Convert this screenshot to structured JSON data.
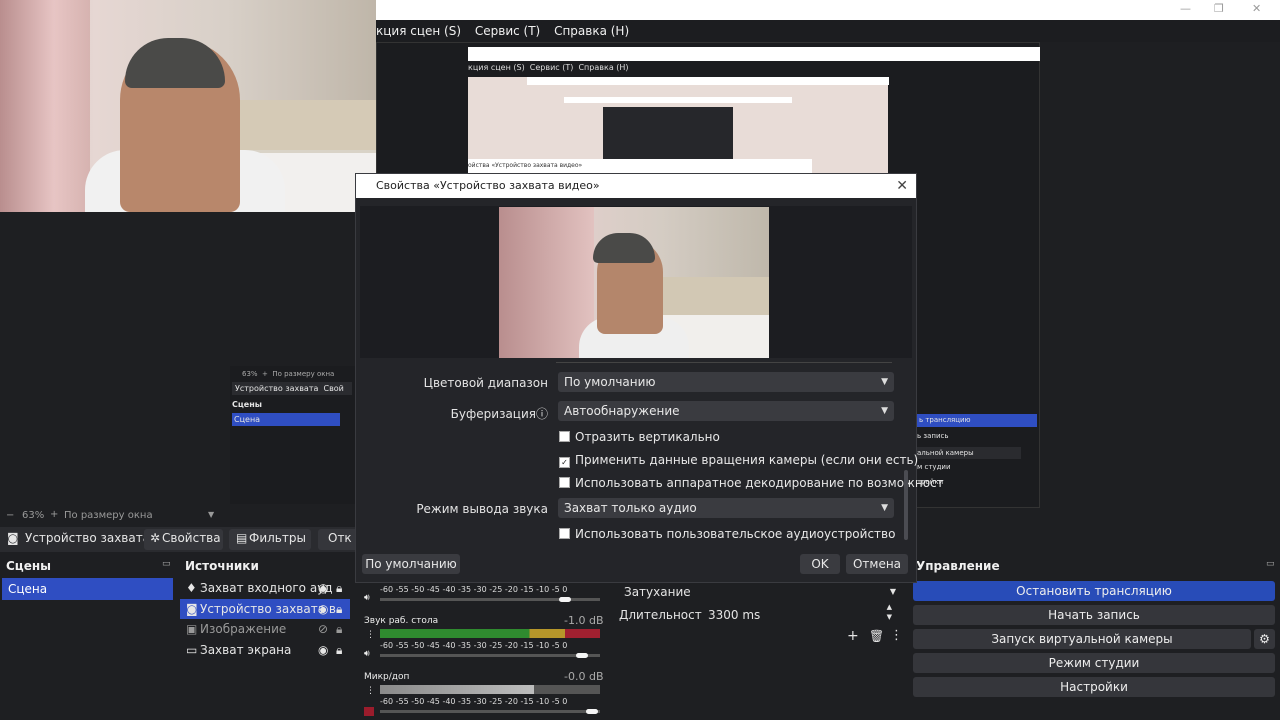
{
  "menu": [
    "кция сцен (S)",
    "Сервис (T)",
    "Справка (H)"
  ],
  "nested": {
    "menu": [
      "кция сцен (S)",
      "Сервис (T)",
      "Справка (H)"
    ],
    "zoom_small": "63%",
    "fit_small": "По размеру окна",
    "source_small": "Устройство захвата",
    "props_small": "Свой",
    "scenes_small": "Сцены",
    "scene_small": "Сцена",
    "ctl_items": [
      "ь трансляцию",
      "ь запись",
      "альной камеры",
      "м студии",
      "тройки"
    ],
    "dialog_title_small": "ойства «Устройство захвата видео»"
  },
  "dialog": {
    "title": "Свойства «Устройство захвата видео»",
    "color_range_label": "Цветовой диапазон",
    "color_range_value": "По умолчанию",
    "buffering_label": "Буферизация",
    "buffering_icon": "ⓘ",
    "buffering_value": "Автообнаружение",
    "check_flip": "Отразить вертикально",
    "check_rotation": "Применить данные вращения камеры (если они есть)",
    "check_hw_decode": "Использовать аппаратное декодирование по возможност",
    "audio_mode_label": "Режим вывода звука",
    "audio_mode_value": "Захват только аудио",
    "check_custom_audio": "Использовать пользовательское аудиоустройство",
    "defaults_button": "По умолчанию",
    "ok_button": "OK",
    "cancel_button": "Отмена"
  },
  "checks": {
    "flip": false,
    "rotation": true,
    "hw_decode": false,
    "custom_audio": false
  },
  "preview_bar": {
    "zoom": "63%",
    "fit": "По размеру окна"
  },
  "source_toolbar": {
    "source": "Устройство захвата",
    "properties": "Свойства",
    "filters": "Фильтры",
    "more": "Отк"
  },
  "scenes": {
    "title": "Сцены",
    "items": [
      "Сцена"
    ]
  },
  "sources": {
    "title": "Источники",
    "items": [
      "Захват входного ауд",
      "Устройство захвата в",
      "Изображение",
      "Захват экрана"
    ]
  },
  "mixer": {
    "scale": "-60 -55 -50 -45 -40 -35 -30 -25 -20 -15 -10 -5 0",
    "channels": [
      {
        "name": "",
        "db": ""
      },
      {
        "name": "Звук раб. стола",
        "db": "-1.0 dB"
      },
      {
        "name": "Микр/доп",
        "db": "-0.0 dB"
      }
    ]
  },
  "transition": {
    "type": "Затухание",
    "duration_label": "Длительность",
    "duration_value": "3300 ms"
  },
  "controls": {
    "title": "Управление",
    "stop_stream": "Остановить трансляцию",
    "start_record": "Начать запись",
    "virtual_cam": "Запуск виртуальной камеры",
    "studio_mode": "Режим студии",
    "settings": "Настройки"
  },
  "colors": {
    "accent": "#284cb8",
    "bg": "#1e1f22",
    "panel": "#35363b"
  }
}
